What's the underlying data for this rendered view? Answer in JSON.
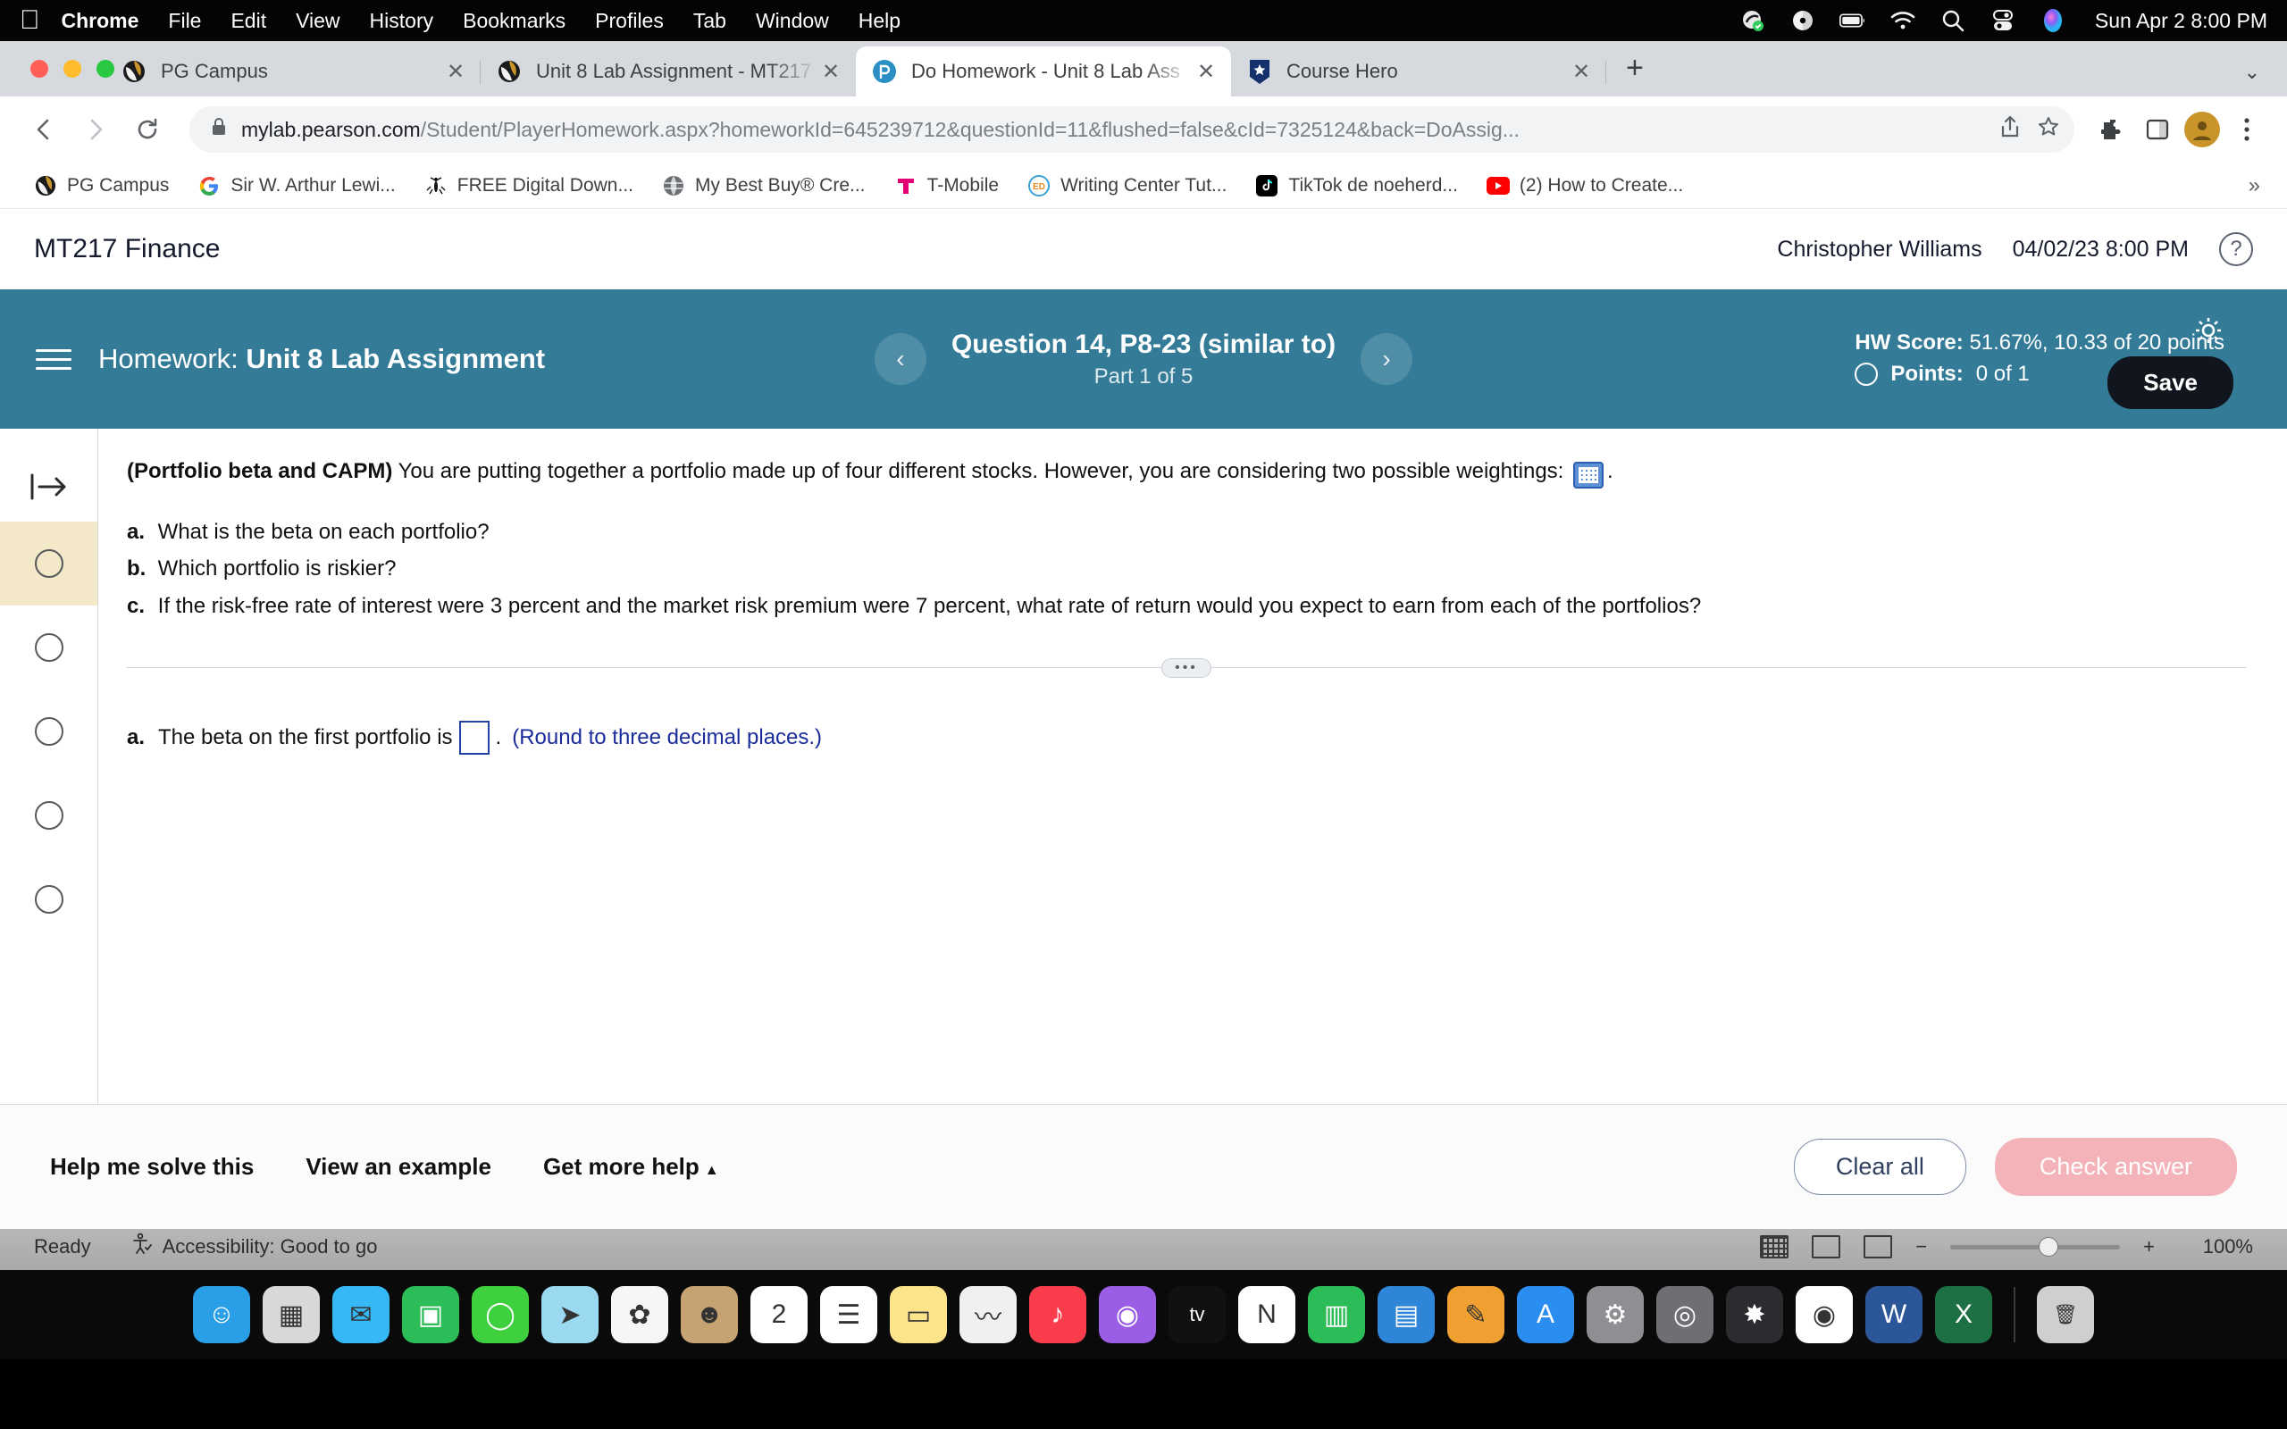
{
  "menubar": {
    "apple_icon": "apple-logo-icon",
    "items": [
      "Chrome",
      "File",
      "Edit",
      "View",
      "History",
      "Bookmarks",
      "Profiles",
      "Tab",
      "Window",
      "Help"
    ],
    "tray_icons": [
      "cloud-sync-icon",
      "disc-icon",
      "battery-icon",
      "wifi-icon",
      "spotlight-search-icon",
      "control-center-icon",
      "siri-icon"
    ],
    "clock": "Sun Apr 2  8:00 PM"
  },
  "browser": {
    "tabs": [
      {
        "title": "PG Campus",
        "favicon": "pg-campus-icon",
        "active": false
      },
      {
        "title": "Unit 8 Lab Assignment - MT217",
        "favicon": "pg-campus-icon",
        "active": false
      },
      {
        "title": "Do Homework - Unit 8 Lab Ass",
        "favicon": "pearson-icon",
        "active": true
      },
      {
        "title": "Course Hero",
        "favicon": "course-hero-icon",
        "active": false
      }
    ],
    "new_tab_label": "+",
    "tab_list_chevron": "chevron-down-icon",
    "omnibox": {
      "host": "mylab.pearson.com",
      "path": "/Student/PlayerHomework.aspx?homeworkId=645239712&questionId=11&flushed=false&cId=7325124&back=DoAssig...",
      "lock_icon": "lock-icon"
    },
    "toolbar_icons": [
      "back-arrow-icon",
      "forward-arrow-icon",
      "reload-icon",
      "share-icon",
      "bookmark-star-icon",
      "extensions-puzzle-icon",
      "side-panel-icon",
      "profile-avatar-icon",
      "chrome-menu-icon"
    ],
    "bookmarks": [
      {
        "label": "PG Campus",
        "icon": "pg-campus-icon"
      },
      {
        "label": "Sir W. Arthur Lewi...",
        "icon": "google-icon"
      },
      {
        "label": "FREE Digital Down...",
        "icon": "mosquito-icon"
      },
      {
        "label": "My Best Buy® Cre...",
        "icon": "globe-icon"
      },
      {
        "label": "T-Mobile",
        "icon": "tmobile-icon"
      },
      {
        "label": "Writing Center Tut...",
        "icon": "ed-icon"
      },
      {
        "label": "TikTok de noeherd...",
        "icon": "tiktok-icon"
      },
      {
        "label": "(2) How to Create...",
        "icon": "youtube-icon"
      }
    ],
    "bookmarks_overflow": "»"
  },
  "mylab": {
    "course_title": "MT217 Finance",
    "student_name": "Christopher Williams",
    "datetime": "04/02/23 8:00 PM",
    "help_icon_label": "?",
    "banner": {
      "menu_icon": "hamburger-menu-icon",
      "homework_prefix": "Homework:",
      "homework_name": "Unit 8 Lab Assignment",
      "prev_icon": "‹",
      "next_icon": "›",
      "question_title": "Question 14, P8-23 (similar to)",
      "question_part": "Part 1 of 5",
      "hw_score_label": "HW Score:",
      "hw_score_value": "51.67%, 10.33 of 20 points",
      "points_label": "Points:",
      "points_value": "0 of 1",
      "settings_icon": "gear-icon",
      "save_label": "Save",
      "accent_color": "#347b98"
    },
    "question": {
      "topic": "(Portfolio beta and CAPM)",
      "stem": "You are putting together a portfolio made up of four different stocks.  However, you are considering two possible weightings:",
      "table_icon": "spreadsheet-popup-icon",
      "stem_suffix": ".",
      "parts": [
        {
          "label": "a.",
          "text": "What is the beta on each portfolio?"
        },
        {
          "label": "b.",
          "text": "Which portfolio is riskier?"
        },
        {
          "label": "c.",
          "text": "If the risk-free rate of interest were 3 percent and the market risk premium were 7 percent, what rate of return would you expect to earn from each of the portfolios?"
        }
      ],
      "divider_glyph": "•••",
      "answer": {
        "label": "a.",
        "prefix": "The beta on the first portfolio is",
        "input_value": "",
        "suffix": ".",
        "note": "(Round to three decimal places.)"
      },
      "rail": {
        "expand_icon": "expand-panel-icon",
        "step_icons": [
          "step-circle-icon",
          "step-circle-icon",
          "step-circle-icon",
          "step-circle-icon",
          "step-circle-icon",
          "step-circle-icon"
        ]
      }
    },
    "footer": {
      "help_me_solve": "Help me solve this",
      "view_example": "View an example",
      "get_more_help": "Get more help",
      "get_more_help_caret": "▲",
      "clear_all": "Clear all",
      "check_answer": "Check answer"
    }
  },
  "statusbar": {
    "ready": "Ready",
    "accessibility_icon": "accessibility-person-icon",
    "accessibility": "Accessibility: Good to go",
    "view_icons": [
      "grid-view-icon",
      "reading-view-icon",
      "web-layout-icon"
    ],
    "zoom_out": "−",
    "zoom_in": "+",
    "zoom_level": "100%"
  },
  "dock": {
    "items": [
      {
        "name": "finder-icon",
        "color": "#2a9fe8",
        "glyph": "☺"
      },
      {
        "name": "launchpad-icon",
        "color": "#d8d8d8",
        "glyph": "▦"
      },
      {
        "name": "mail-icon",
        "color": "#35b8f5",
        "glyph": "✉"
      },
      {
        "name": "facetime-icon",
        "color": "#2dbd58",
        "glyph": "▣"
      },
      {
        "name": "messages-icon",
        "color": "#3fd03f",
        "glyph": "◯"
      },
      {
        "name": "maps-icon",
        "color": "#9bd9f0",
        "glyph": "➤"
      },
      {
        "name": "photos-icon",
        "color": "#f6f6f6",
        "glyph": "✿"
      },
      {
        "name": "contacts-icon",
        "color": "#c7a374",
        "glyph": "☻"
      },
      {
        "name": "calendar-icon",
        "color": "#ffffff",
        "glyph": "2"
      },
      {
        "name": "reminders-icon",
        "color": "#ffffff",
        "glyph": "☰"
      },
      {
        "name": "notes-icon",
        "color": "#fbe48a",
        "glyph": "▭"
      },
      {
        "name": "freeform-icon",
        "color": "#f0f0f0",
        "glyph": "〰"
      },
      {
        "name": "music-icon",
        "color": "#fa3c4c",
        "glyph": "♪"
      },
      {
        "name": "podcasts-icon",
        "color": "#9b5de5",
        "glyph": "◉"
      },
      {
        "name": "appletv-icon",
        "color": "#111111",
        "glyph": "tv"
      },
      {
        "name": "news-icon",
        "color": "#ffffff",
        "glyph": "N"
      },
      {
        "name": "numbers-icon",
        "color": "#2dbd58",
        "glyph": "▥"
      },
      {
        "name": "keynote-icon",
        "color": "#2f86d8",
        "glyph": "▤"
      },
      {
        "name": "pages-icon",
        "color": "#f0a030",
        "glyph": "✎"
      },
      {
        "name": "appstore-icon",
        "color": "#2a8ef0",
        "glyph": "A"
      },
      {
        "name": "settings-icon",
        "color": "#8e8e93",
        "glyph": "⚙"
      },
      {
        "name": "preferences-icon",
        "color": "#6e6e73",
        "glyph": "◎"
      },
      {
        "name": "siri-icon",
        "color": "#2b2b30",
        "glyph": "✸"
      },
      {
        "name": "chrome-icon",
        "color": "#ffffff",
        "glyph": "◉"
      },
      {
        "name": "word-icon",
        "color": "#2b579a",
        "glyph": "W"
      },
      {
        "name": "excel-icon",
        "color": "#1d7044",
        "glyph": "X"
      },
      {
        "name": "trash-icon",
        "color": "#cfcfcf",
        "glyph": "🗑"
      }
    ]
  }
}
